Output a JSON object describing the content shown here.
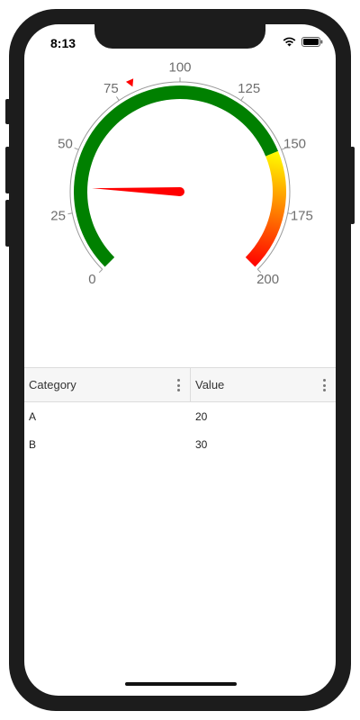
{
  "status_bar": {
    "time": "8:13"
  },
  "gauge": {
    "min": 0,
    "max": 200,
    "value": 35,
    "marker_value": 82,
    "tick_labels": [
      "0",
      "25",
      "50",
      "75",
      "100",
      "125",
      "150",
      "175",
      "200"
    ],
    "ranges": [
      {
        "from": 0,
        "to": 150,
        "color": "#008000"
      },
      {
        "from": 150,
        "to": 200,
        "gradient": [
          "#ffff00",
          "#ff0000"
        ]
      }
    ],
    "needle_color": "#ff0000",
    "marker_color": "#ff0000",
    "label_color": "#6e6e6e"
  },
  "grid": {
    "columns": [
      {
        "label": "Category"
      },
      {
        "label": "Value"
      }
    ],
    "rows": [
      {
        "category": "A",
        "value": "20"
      },
      {
        "category": "B",
        "value": "30"
      }
    ]
  }
}
